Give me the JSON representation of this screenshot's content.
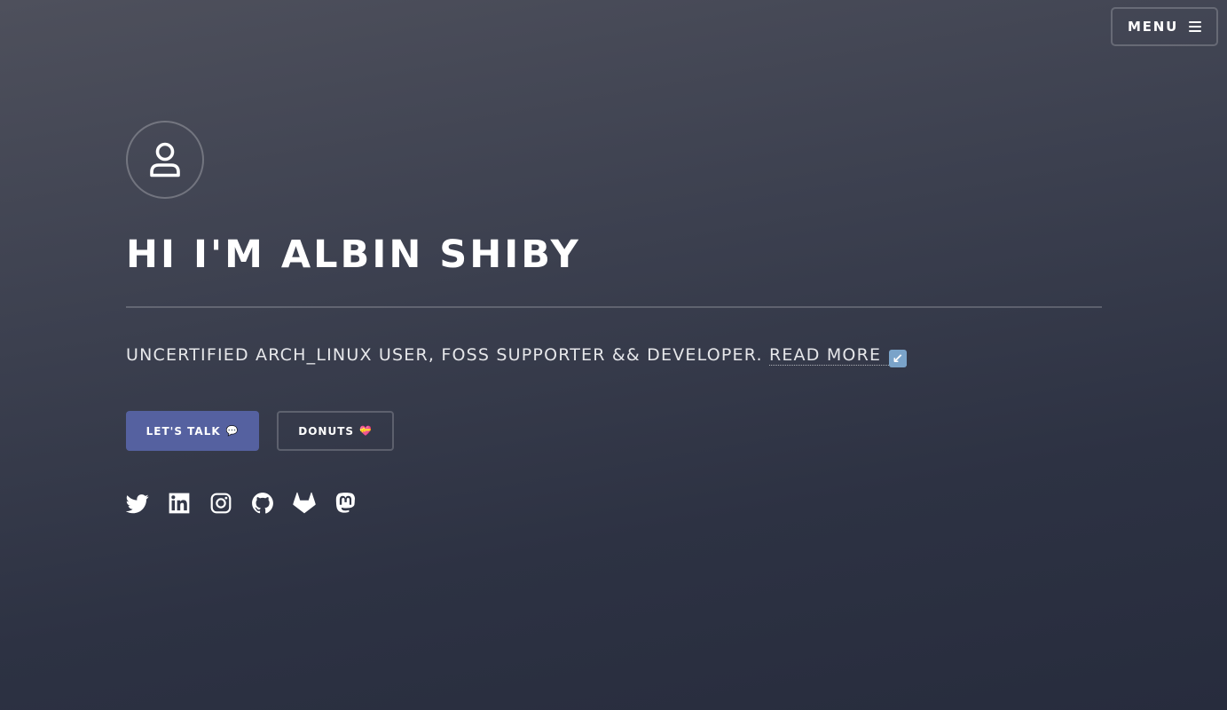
{
  "header": {
    "menu_label": "MENU"
  },
  "hero": {
    "title": "HI I'M ALBIN SHIBY",
    "subtitle": "UNCERTIFIED ARCH_LINUX USER, FOSS SUPPORTER && DEVELOPER.",
    "read_more": "READ MORE",
    "read_more_emoji": "↙"
  },
  "buttons": {
    "talk_label": "LET'S TALK",
    "talk_emoji": "💬",
    "donuts_label": "DONUTS",
    "donuts_emoji": "💝"
  },
  "social": [
    {
      "name": "twitter-icon"
    },
    {
      "name": "linkedin-icon"
    },
    {
      "name": "instagram-icon"
    },
    {
      "name": "github-icon"
    },
    {
      "name": "gitlab-icon"
    },
    {
      "name": "mastodon-icon"
    }
  ],
  "colors": {
    "accent": "#5561a0",
    "background_top": "#4e505c",
    "background_bottom": "#272c3d",
    "text": "#ffffff"
  }
}
